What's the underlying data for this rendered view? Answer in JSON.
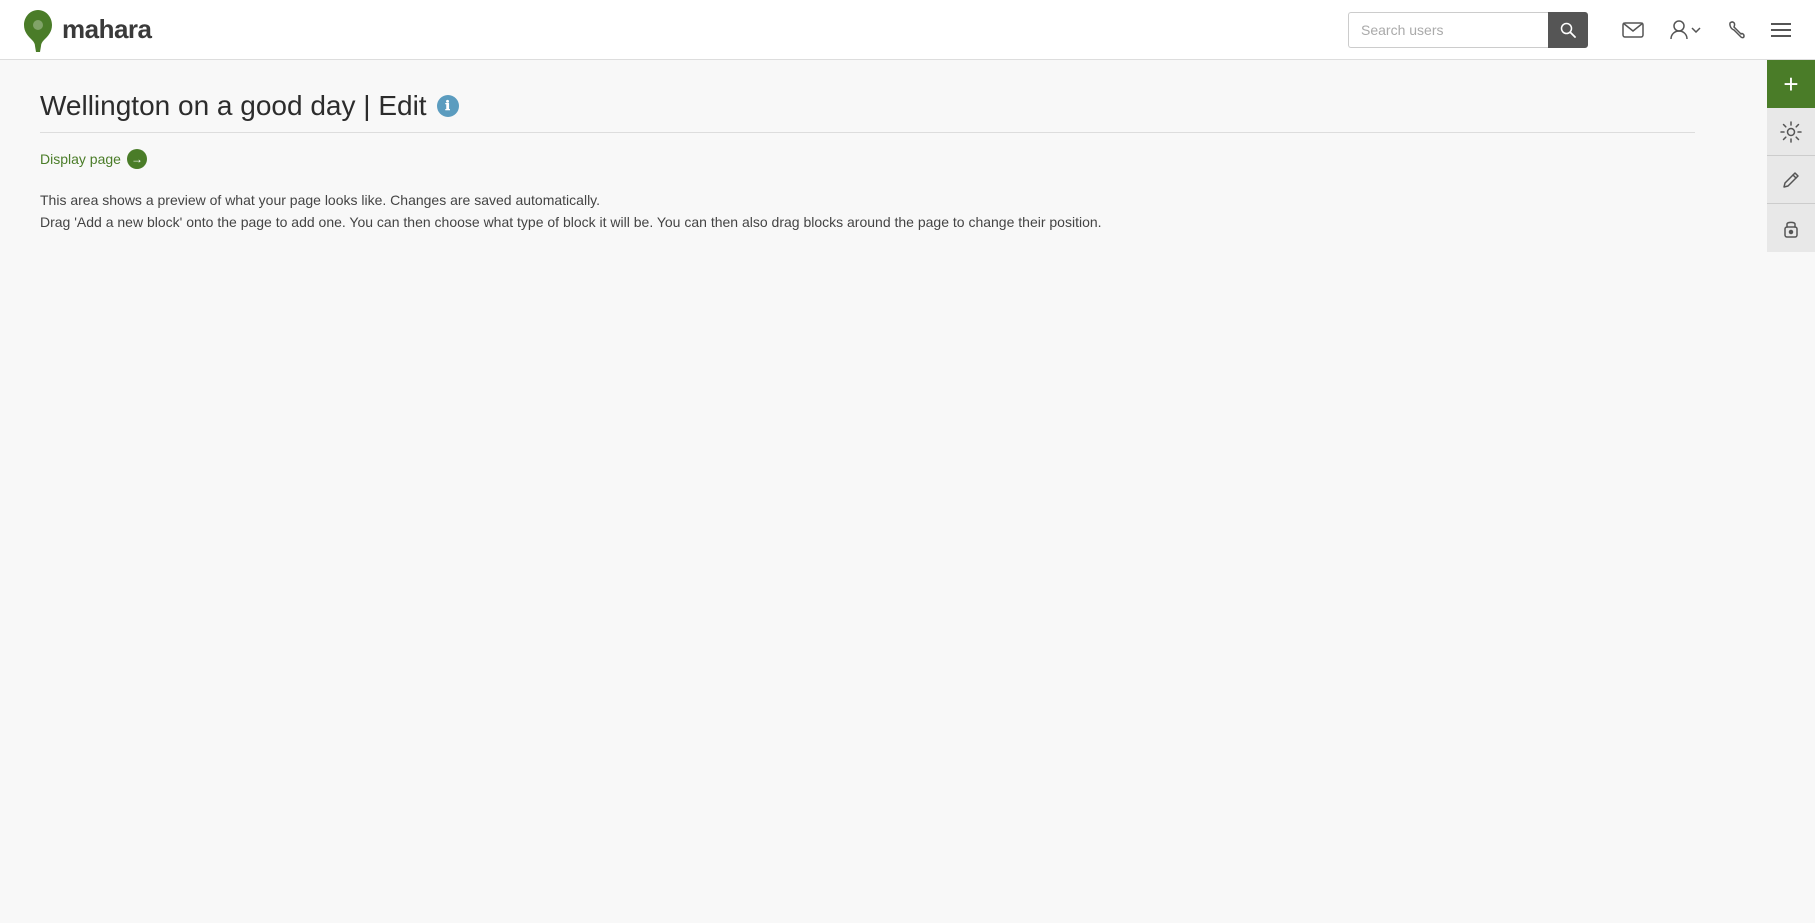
{
  "header": {
    "logo_alt": "Mahara",
    "logo_text": "mahara",
    "search_placeholder": "Search users",
    "search_button_label": "Search"
  },
  "nav": {
    "mail_icon": "mail-icon",
    "user_icon": "user-icon",
    "wrench_icon": "wrench-icon",
    "menu_icon": "menu-icon"
  },
  "page": {
    "title": "Wellington on a good day | Edit",
    "display_page_label": "Display page",
    "info_icon_label": "ℹ",
    "preview_line1": "This area shows a preview of what your page looks like. Changes are saved automatically.",
    "preview_line2": "Drag 'Add a new block' onto the page to add one. You can then choose what type of block it will be. You can then also drag blocks around the page to change their position."
  },
  "sidebar": {
    "add_label": "+",
    "settings_icon": "⚙",
    "edit_icon": "✏",
    "lock_icon": "🔒"
  },
  "colors": {
    "green": "#4a7c28",
    "info_blue": "#5b9cbf",
    "header_bg": "#ffffff",
    "sidebar_btn_bg": "#e8e8e8"
  }
}
